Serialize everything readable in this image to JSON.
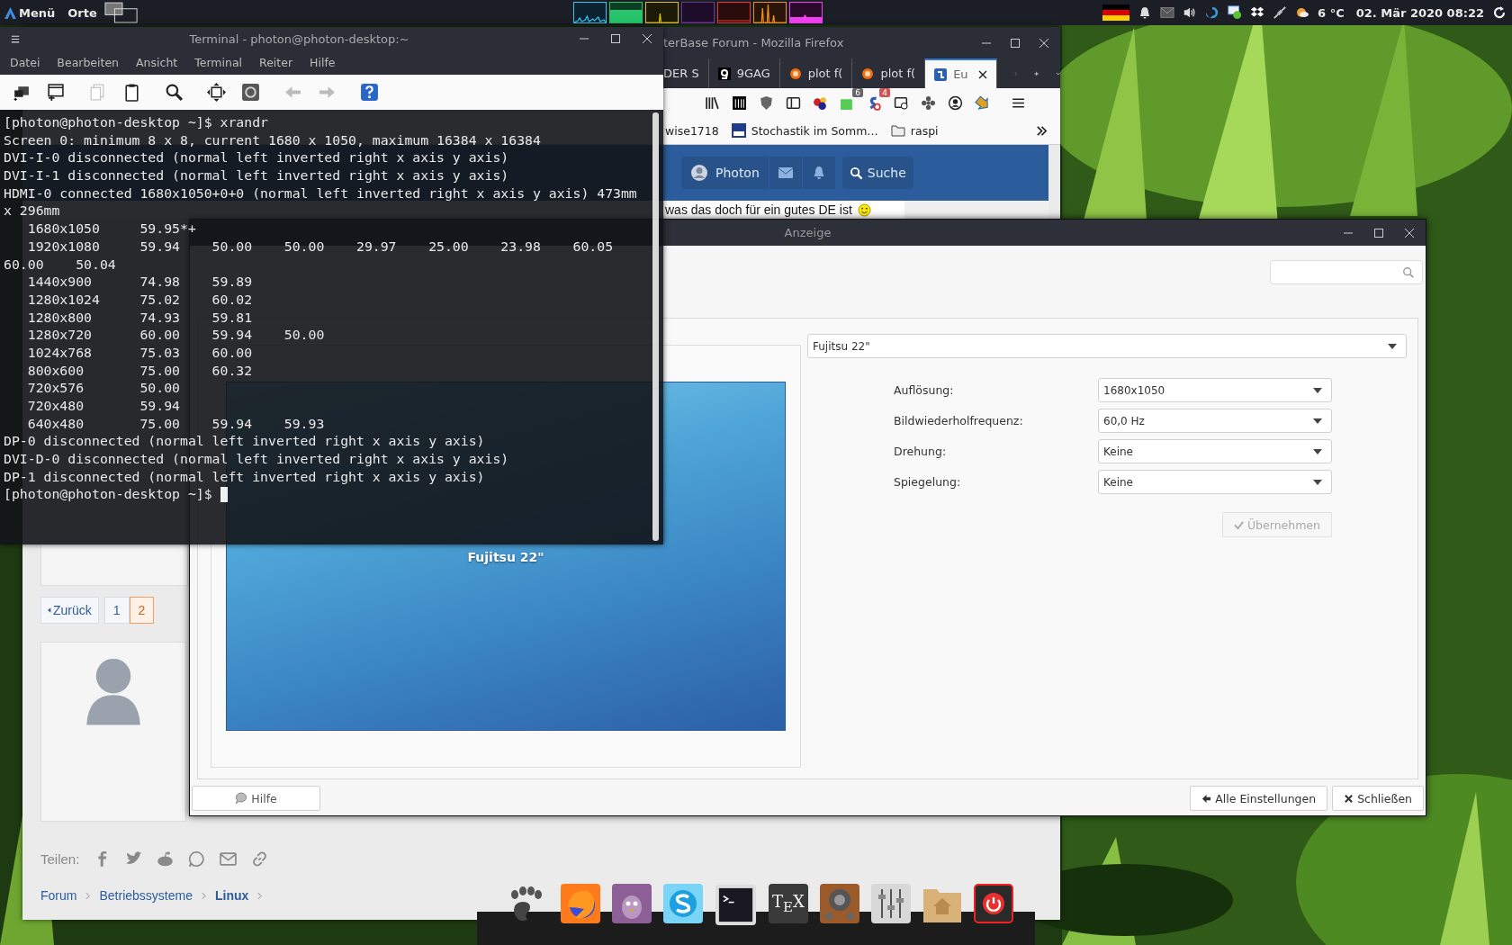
{
  "top_panel": {
    "menu": "Menü",
    "places": "Orte",
    "weather": "6 °C",
    "clock": "02. Mär 2020 08:22"
  },
  "terminal": {
    "title": "Terminal - photon@photon-desktop:~",
    "menu": [
      "Datei",
      "Bearbeiten",
      "Ansicht",
      "Terminal",
      "Reiter",
      "Hilfe"
    ],
    "lines": [
      "[photon@photon-desktop ~]$ xrandr",
      "Screen 0: minimum 8 x 8, current 1680 x 1050, maximum 16384 x 16384",
      "DVI-I-0 disconnected (normal left inverted right x axis y axis)",
      "DVI-I-1 disconnected (normal left inverted right x axis y axis)",
      "HDMI-0 connected 1680x1050+0+0 (normal left inverted right x axis y axis) 473mm",
      "x 296mm",
      "   1680x1050     59.95*+",
      "   1920x1080     59.94    50.00    50.00    29.97    25.00    23.98    60.05",
      "60.00    50.04",
      "   1440x900      74.98    59.89",
      "   1280x1024     75.02    60.02",
      "   1280x800      74.93    59.81",
      "   1280x720      60.00    59.94    50.00",
      "   1024x768      75.03    60.00",
      "   800x600       75.00    60.32",
      "   720x576       50.00",
      "   720x480       59.94",
      "   640x480       75.00    59.94    59.93",
      "DP-0 disconnected (normal left inverted right x axis y axis)",
      "DVI-D-0 disconnected (normal left inverted right x axis y axis)",
      "DP-1 disconnected (normal left inverted right x axis y axis)",
      "[photon@photon-desktop ~]$ "
    ]
  },
  "firefox": {
    "title": "terBase Forum - Mozilla Firefox",
    "tabs": [
      {
        "label": "DER S",
        "selected": false
      },
      {
        "label": "9GAG",
        "selected": false
      },
      {
        "label": "plot f(",
        "selected": false
      },
      {
        "label": "plot f(",
        "selected": false
      },
      {
        "label": "Eu",
        "selected": true
      }
    ],
    "toolbar_badges": [
      "6",
      "4"
    ],
    "bookmarks": [
      "wise1718",
      "Stochastik im Somm…",
      "raspi"
    ],
    "nav": {
      "user": "Photon",
      "search": "Suche"
    },
    "post_text": "was das doch für ein gutes DE ist",
    "pagination": {
      "back": "Zurück",
      "pages": [
        {
          "label": "1",
          "selected": false
        },
        {
          "label": "2",
          "selected": true
        }
      ]
    },
    "share_label": "Teilen:",
    "breadcrumb": [
      {
        "label": "Forum",
        "current": false
      },
      {
        "label": "Betriebssysteme",
        "current": false
      },
      {
        "label": "Linux",
        "current": true
      }
    ]
  },
  "display_dialog": {
    "title": "Anzeige",
    "preview_label": "Fujitsu 22\"",
    "monitor": "Fujitsu 22\"",
    "settings": [
      {
        "label": "Auflösung:",
        "value": "1680x1050"
      },
      {
        "label": "Bildwiederholfrequenz:",
        "value": "60,0 Hz"
      },
      {
        "label": "Drehung:",
        "value": "Keine"
      },
      {
        "label": "Spiegelung:",
        "value": "Keine"
      }
    ],
    "apply": {
      "label": "Übernehmen",
      "disabled": true
    },
    "buttons": {
      "help": "Hilfe",
      "all_settings": "Alle Einstellungen",
      "close": "Schließen"
    }
  },
  "dock": {
    "tex_label": "T$_{E}$X"
  }
}
